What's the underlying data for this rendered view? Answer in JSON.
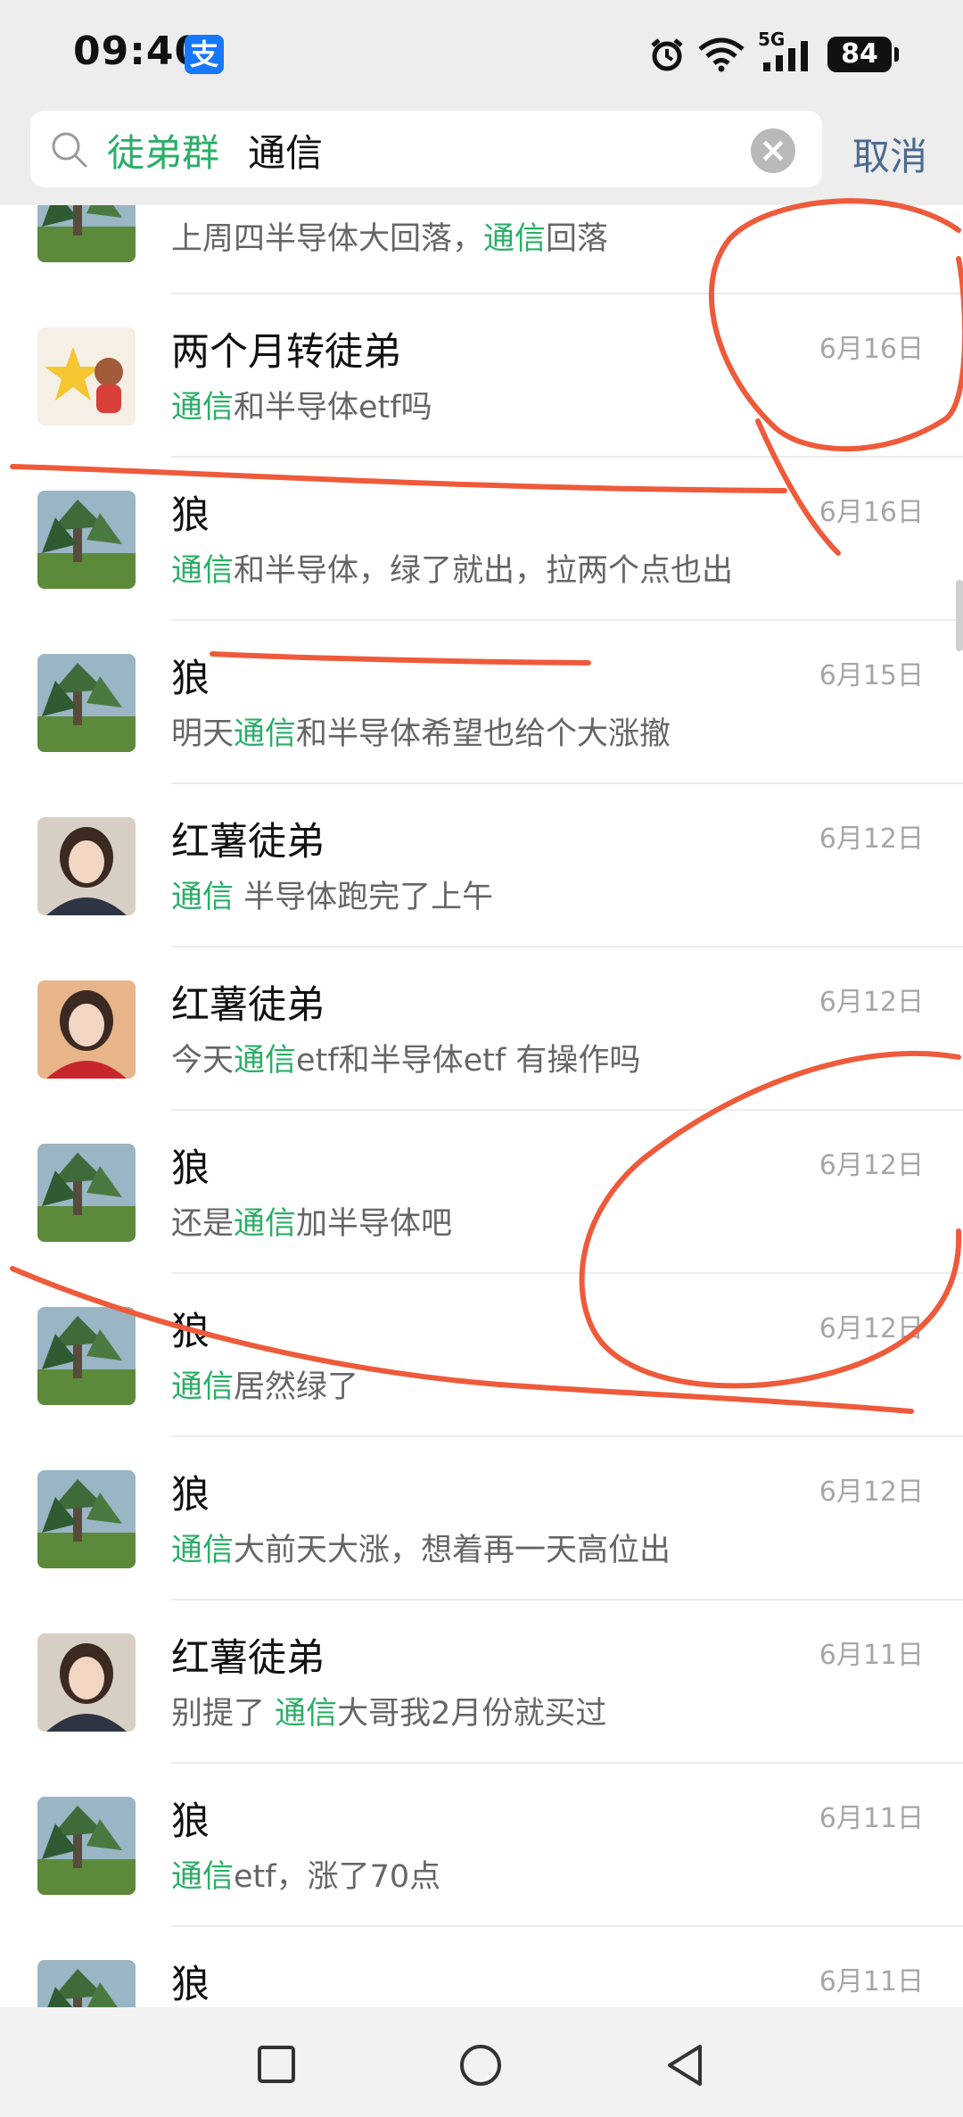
{
  "status_bar": {
    "time": "09:40",
    "app_badge": "支",
    "battery": "84",
    "network": "5G"
  },
  "search": {
    "tag": "徒弟群",
    "query": "通信",
    "cancel_label": "取消"
  },
  "results": [
    {
      "name": "",
      "msg_before": "上周四半导体大回落，",
      "msg_highlight": "通信",
      "msg_after": "回落",
      "date": "",
      "avatar": "tree"
    },
    {
      "name": "两个月转徒弟",
      "msg_before": "",
      "msg_highlight": "通信",
      "msg_after": "和半导体etf吗",
      "date": "6月16日",
      "avatar": "star"
    },
    {
      "name": "狼",
      "msg_before": "",
      "msg_highlight": "通信",
      "msg_after": "和半导体，绿了就出，拉两个点也出",
      "date": "6月16日",
      "avatar": "tree"
    },
    {
      "name": "狼",
      "msg_before": "明天",
      "msg_highlight": "通信",
      "msg_after": "和半导体希望也给个大涨撤",
      "date": "6月15日",
      "avatar": "tree"
    },
    {
      "name": "红薯徒弟",
      "msg_before": "",
      "msg_highlight": "通信",
      "msg_after": " 半导体跑完了上午",
      "date": "6月12日",
      "avatar": "girl"
    },
    {
      "name": "红薯徒弟",
      "msg_before": "今天",
      "msg_highlight": "通信",
      "msg_after": "etf和半导体etf 有操作吗",
      "date": "6月12日",
      "avatar": "girl-red"
    },
    {
      "name": "狼",
      "msg_before": "还是",
      "msg_highlight": "通信",
      "msg_after": "加半导体吧",
      "date": "6月12日",
      "avatar": "tree"
    },
    {
      "name": "狼",
      "msg_before": "",
      "msg_highlight": "通信",
      "msg_after": "居然绿了",
      "date": "6月12日",
      "avatar": "tree"
    },
    {
      "name": "狼",
      "msg_before": "",
      "msg_highlight": "通信",
      "msg_after": "大前天大涨，想着再一天高位出",
      "date": "6月12日",
      "avatar": "tree"
    },
    {
      "name": "红薯徒弟",
      "msg_before": "别提了 ",
      "msg_highlight": "通信",
      "msg_after": "大哥我2月份就买过",
      "date": "6月11日",
      "avatar": "girl"
    },
    {
      "name": "狼",
      "msg_before": "",
      "msg_highlight": "通信",
      "msg_after": "etf，涨了70点",
      "date": "6月11日",
      "avatar": "tree"
    },
    {
      "name": "狼",
      "msg_before": "",
      "msg_highlight": "",
      "msg_after": "",
      "date": "6月11日",
      "avatar": "tree"
    }
  ],
  "colors": {
    "highlight": "#2aae67",
    "annotation": "#ee5a3a",
    "cancel": "#4b6a8f"
  }
}
